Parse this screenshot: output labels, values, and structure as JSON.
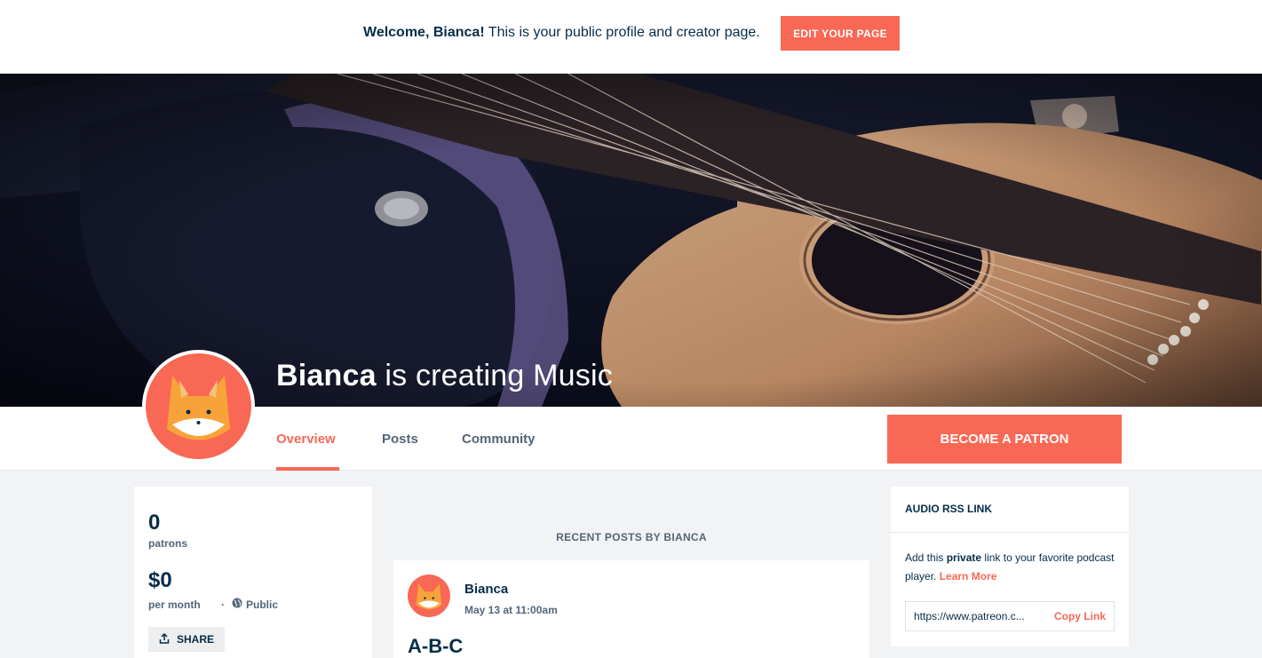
{
  "welcome": {
    "greeting": "Welcome, Bianca!",
    "message": "This is your public profile and creator page.",
    "edit_button": "EDIT YOUR PAGE"
  },
  "cover": {
    "creator_name": "Bianca",
    "creating_text": "is creating Music"
  },
  "avatar": {
    "icon": "fox-avatar-icon"
  },
  "nav": {
    "tabs": [
      {
        "label": "Overview",
        "active": true
      },
      {
        "label": "Posts",
        "active": false
      },
      {
        "label": "Community",
        "active": false
      }
    ],
    "become_patron": "BECOME A PATRON"
  },
  "stats": {
    "patrons_count": "0",
    "patrons_label": "patrons",
    "earnings": "$0",
    "earnings_label": "per month",
    "separator": "·",
    "visibility": "Public",
    "share": "SHARE"
  },
  "posts": {
    "section_label": "RECENT POSTS BY BIANCA",
    "items": [
      {
        "author": "Bianca",
        "date": "May 13 at 11:00am",
        "title": "A-B-C"
      }
    ]
  },
  "rss": {
    "title": "AUDIO RSS LINK",
    "desc_pre": "Add this",
    "desc_bold": "private",
    "desc_post": "link to your favorite podcast player.",
    "learn_more": "Learn More",
    "url": "https://www.patreon.c...",
    "copy": "Copy Link"
  },
  "colors": {
    "accent": "#f96854",
    "navy": "#052d49",
    "muted": "#52667a",
    "background": "#f2f3f5"
  }
}
